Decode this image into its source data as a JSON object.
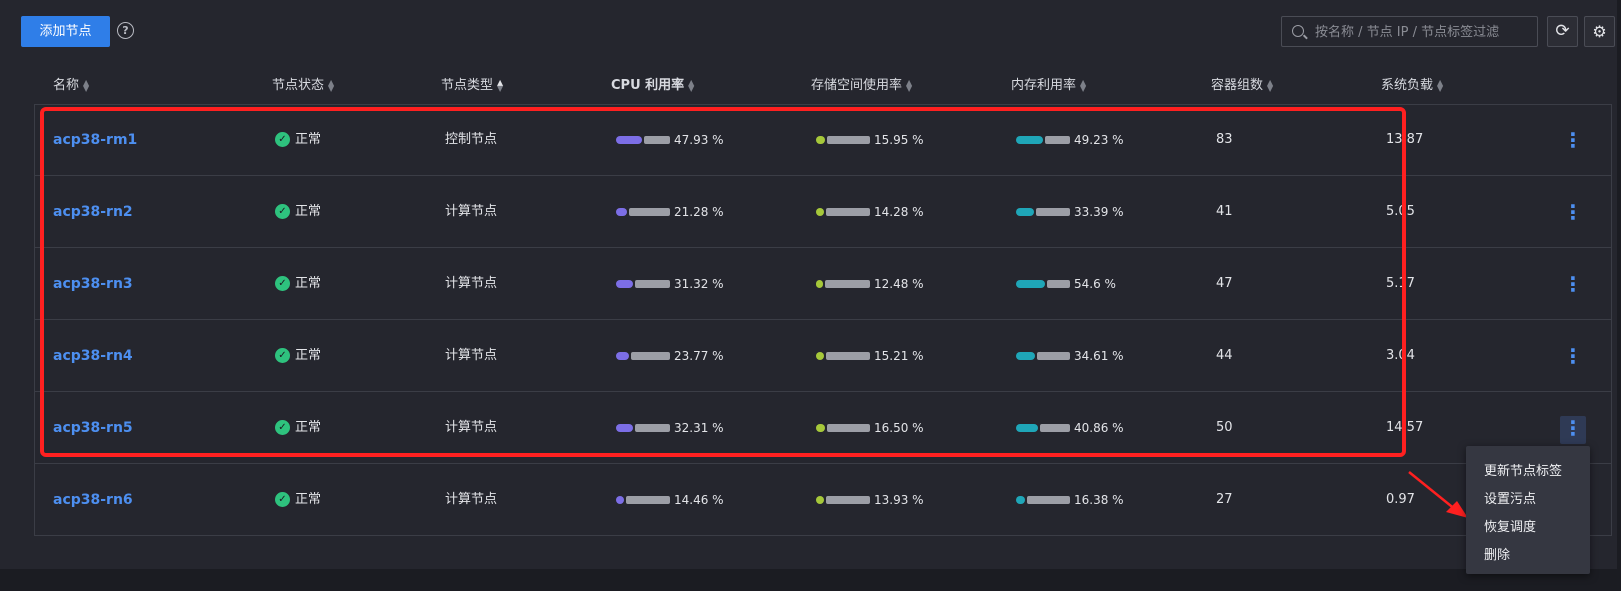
{
  "toolbar": {
    "add_label": "添加节点",
    "help_glyph": "?",
    "search_placeholder": "按名称 / 节点 IP / 节点标签过滤",
    "refresh_glyph": "⟳",
    "settings_glyph": "⚙"
  },
  "columns": [
    "名称",
    "节点状态",
    "节点类型",
    "CPU 利用率",
    "存储空间使用率",
    "内存利用率",
    "容器组数",
    "系统负载"
  ],
  "status_ok_glyph": "✓",
  "more_glyph": "⋮",
  "bar_colors": {
    "cpu": "#7c6ee6",
    "storage": "#a6c83a",
    "memory": "#1fa6b8"
  },
  "rows": [
    {
      "name": "acp38-rm1",
      "status": "正常",
      "type": "控制节点",
      "cpu": "47.93 %",
      "cpu_pct": 47.93,
      "storage": "15.95 %",
      "storage_pct": 15.95,
      "memory": "49.23 %",
      "memory_pct": 49.23,
      "pods": "83",
      "load": "13.87"
    },
    {
      "name": "acp38-rn2",
      "status": "正常",
      "type": "计算节点",
      "cpu": "21.28 %",
      "cpu_pct": 21.28,
      "storage": "14.28 %",
      "storage_pct": 14.28,
      "memory": "33.39 %",
      "memory_pct": 33.39,
      "pods": "41",
      "load": "5.05"
    },
    {
      "name": "acp38-rn3",
      "status": "正常",
      "type": "计算节点",
      "cpu": "31.32 %",
      "cpu_pct": 31.32,
      "storage": "12.48 %",
      "storage_pct": 12.48,
      "memory": "54.6 %",
      "memory_pct": 54.6,
      "pods": "47",
      "load": "5.17"
    },
    {
      "name": "acp38-rn4",
      "status": "正常",
      "type": "计算节点",
      "cpu": "23.77 %",
      "cpu_pct": 23.77,
      "storage": "15.21 %",
      "storage_pct": 15.21,
      "memory": "34.61 %",
      "memory_pct": 34.61,
      "pods": "44",
      "load": "3.04"
    },
    {
      "name": "acp38-rn5",
      "status": "正常",
      "type": "计算节点",
      "cpu": "32.31 %",
      "cpu_pct": 32.31,
      "storage": "16.50 %",
      "storage_pct": 16.5,
      "memory": "40.86 %",
      "memory_pct": 40.86,
      "pods": "50",
      "load": "14.57"
    },
    {
      "name": "acp38-rn6",
      "status": "正常",
      "type": "计算节点",
      "cpu": "14.46 %",
      "cpu_pct": 14.46,
      "storage": "13.93 %",
      "storage_pct": 13.93,
      "memory": "16.38 %",
      "memory_pct": 16.38,
      "pods": "27",
      "load": "0.97"
    }
  ],
  "context_menu": [
    "更新节点标签",
    "设置污点",
    "恢复调度",
    "删除"
  ]
}
